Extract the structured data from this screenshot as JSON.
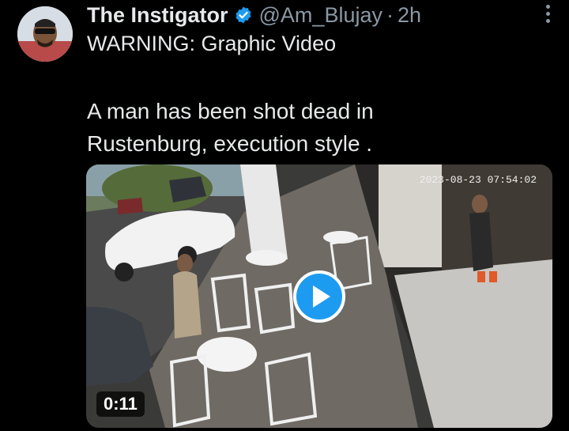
{
  "tweet": {
    "display_name": "The Instigator",
    "handle": "@Am_Blujay",
    "separator": "·",
    "time": "2h",
    "warning": "WARNING: Graphic Video",
    "body_lines": [
      "A man has been shot dead in",
      "Rustenburg,  execution style ."
    ],
    "media": {
      "timestamp": "2023-08-23 07:54:02",
      "duration": "0:11",
      "play_icon": "play-icon"
    }
  },
  "colors": {
    "background": "#000000",
    "text": "#e7e9ea",
    "muted": "#8b98a5",
    "verified": "#1d9bf0",
    "play_button": "#1d9bf0"
  }
}
